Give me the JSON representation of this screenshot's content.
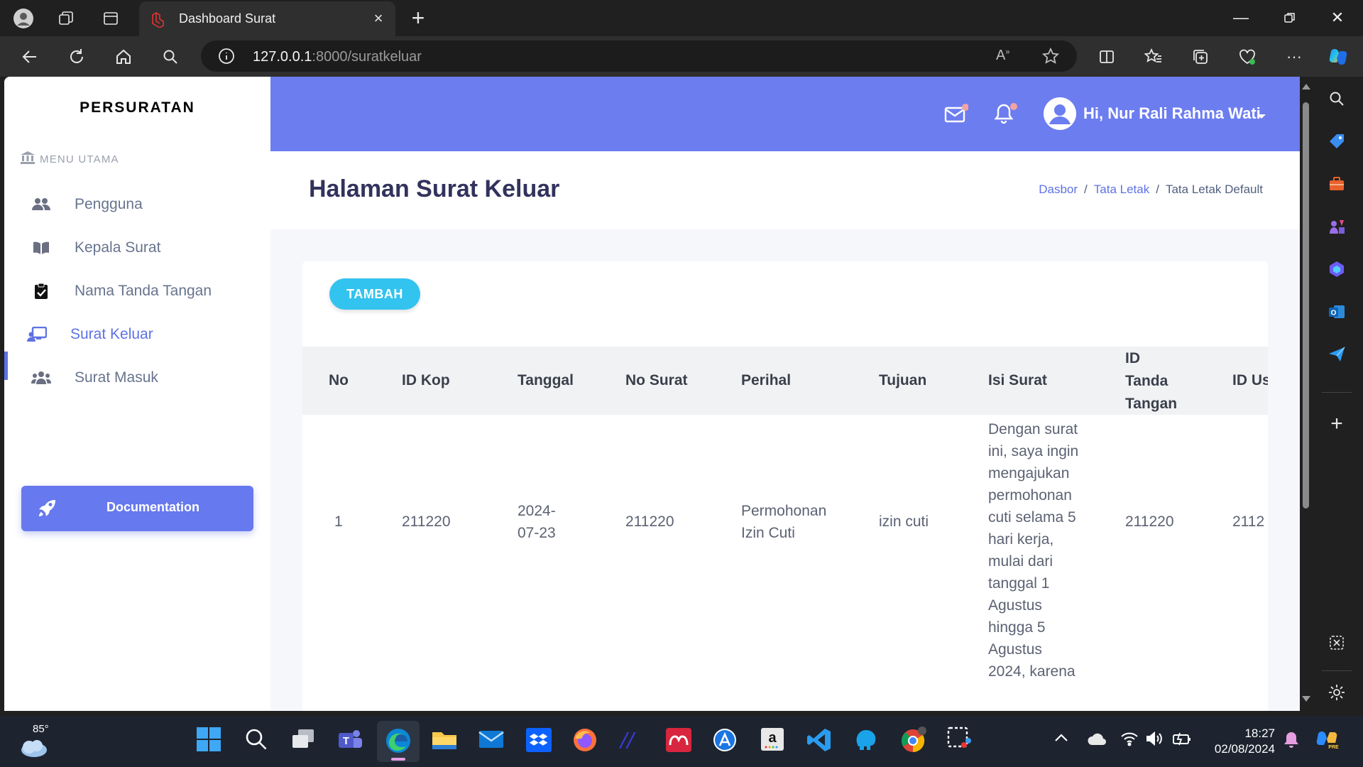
{
  "browser": {
    "tab_title": "Dashboard Surat",
    "url_host": "127.0.0.1",
    "url_path": ":8000/suratkeluar"
  },
  "sidebar": {
    "brand": "PERSURATAN",
    "menu_heading": "MENU UTAMA",
    "items": [
      {
        "label": "Pengguna",
        "icon": "users-icon"
      },
      {
        "label": "Kepala Surat",
        "icon": "book-icon"
      },
      {
        "label": "Nama Tanda Tangan",
        "icon": "clipboard-check-icon"
      },
      {
        "label": "Surat Keluar",
        "icon": "chalkboard-user-icon",
        "active": true
      },
      {
        "label": "Surat Masuk",
        "icon": "user-group-icon"
      }
    ],
    "documentation_label": "Documentation"
  },
  "topbar": {
    "user_greeting": "Hi, Nur Rali Rahma Wati"
  },
  "header": {
    "title": "Halaman Surat Keluar",
    "breadcrumb": [
      "Dasbor",
      "Tata Letak",
      "Tata Letak Default"
    ]
  },
  "card": {
    "add_button": "TAMBAH",
    "columns": [
      "No",
      "ID Kop",
      "Tanggal",
      "No Surat",
      "Perihal",
      "Tujuan",
      "Isi Surat",
      "ID Tanda Tangan",
      "ID Us"
    ],
    "rows": [
      {
        "no": "1",
        "id_kop": "211220",
        "tanggal": "2024-07-23",
        "no_surat": "211220",
        "perihal": "Permohonan Izin Cuti",
        "tujuan": "izin cuti",
        "isi_surat": "Dengan surat ini, saya ingin mengajukan permohonan cuti selama 5 hari kerja, mulai dari tanggal 1 Agustus hingga 5 Agustus 2024, karena",
        "id_tanda_tangan": "211220",
        "id_user": "2112"
      }
    ]
  },
  "taskbar": {
    "weather_temp": "85°",
    "time": "18:27",
    "date": "02/08/2024"
  },
  "colors": {
    "accent": "#5e72e4",
    "topbar": "#6c7df0",
    "add_button": "#33c3ef"
  }
}
